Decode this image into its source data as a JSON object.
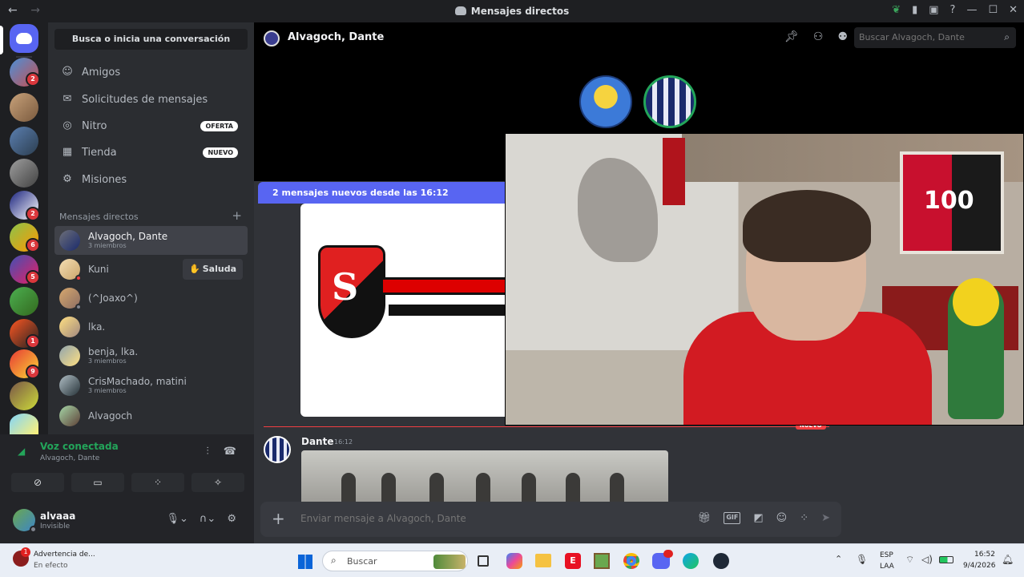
{
  "window": {
    "title": "Mensajes directos",
    "nav_back": "←",
    "nav_forward": "→",
    "controls": [
      "—",
      "☐",
      "✕"
    ]
  },
  "servers": [
    {
      "name": "home",
      "badge": ""
    },
    {
      "name": "dm-avatar",
      "badge": "2"
    },
    {
      "name": "server-1",
      "badge": ""
    },
    {
      "name": "server-2",
      "badge": ""
    },
    {
      "name": "server-3",
      "badge": ""
    },
    {
      "name": "server-4",
      "badge": "2"
    },
    {
      "name": "server-5",
      "badge": "6"
    },
    {
      "name": "server-6",
      "badge": "5"
    },
    {
      "name": "server-7",
      "badge": ""
    },
    {
      "name": "server-8",
      "badge": "1"
    },
    {
      "name": "server-9",
      "badge": "9"
    },
    {
      "name": "server-10",
      "badge": ""
    },
    {
      "name": "server-11",
      "badge": ""
    }
  ],
  "sidebar": {
    "search_label": "Busca o inicia una conversación",
    "nav": [
      {
        "label": "Amigos",
        "icon": "friends-icon",
        "tag": ""
      },
      {
        "label": "Solicitudes de mensajes",
        "icon": "mail-icon",
        "tag": ""
      },
      {
        "label": "Nitro",
        "icon": "nitro-icon",
        "tag": "OFERTA"
      },
      {
        "label": "Tienda",
        "icon": "shop-icon",
        "tag": "NUEVO"
      },
      {
        "label": "Misiones",
        "icon": "quests-icon",
        "tag": ""
      }
    ],
    "dm_header": "Mensajes directos",
    "dms": [
      {
        "name": "Alvagoch, Dante",
        "sub": "3 miembros",
        "active": true
      },
      {
        "name": "Kuni",
        "sub": "",
        "action": "Saluda"
      },
      {
        "name": "(^Joaxo^)",
        "sub": ""
      },
      {
        "name": "lka.",
        "sub": ""
      },
      {
        "name": "benja, lka.",
        "sub": "3 miembros"
      },
      {
        "name": "CrisMachado, matini",
        "sub": "3 miembros"
      },
      {
        "name": "Alvagoch",
        "sub": ""
      }
    ]
  },
  "voice": {
    "status": "Voz conectada",
    "channel": "Alvagoch, Dante"
  },
  "user": {
    "name": "alvaaa",
    "status": "Invisible"
  },
  "channel": {
    "name": "Alvagoch, Dante",
    "search_placeholder": "Buscar Alvagoch, Dante",
    "new_messages": "2 mensajes nuevos desde las 16:12",
    "new_divider": "NUEVO",
    "message": {
      "author": "Dante",
      "time": "16:12"
    },
    "composer_placeholder": "Enviar mensaje a Alvagoch, Dante",
    "gif_label": "GIF"
  },
  "camera": {
    "poster_text": "100"
  },
  "taskbar": {
    "notification_title": "Advertencia de...",
    "notification_sub": "En efecto",
    "search_placeholder": "Buscar",
    "lang_top": "ESP",
    "lang_bottom": "LAA",
    "time": "16:52",
    "date": "9/4/2026"
  },
  "colors": {
    "accent": "#5865f2",
    "online_green": "#23a55a",
    "badge_red": "#da373c"
  }
}
